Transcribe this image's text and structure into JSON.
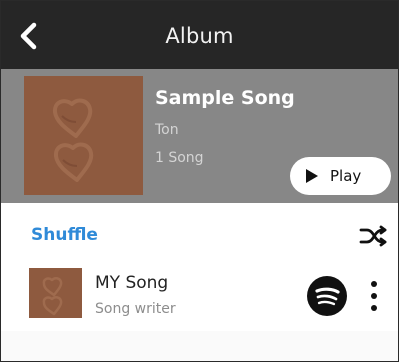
{
  "header": {
    "title": "Album",
    "back_icon": "chevron-left-icon"
  },
  "album": {
    "title": "Sample Song",
    "artist": "Ton",
    "song_count": "1 Song",
    "play_label": "Play",
    "play_icon": "play-icon",
    "cover_art_icon": "album-cover-art"
  },
  "shuffle": {
    "label": "Shuffle",
    "icon": "shuffle-icon"
  },
  "song": {
    "title": "MY Song",
    "writer": "Song writer",
    "service_icon": "spotify-icon",
    "more_icon": "more-vertical-icon"
  },
  "colors": {
    "header_bg": "#262626",
    "album_panel_bg": "#878787",
    "cover_art": "#8e5a3f",
    "shuffle_accent": "#2f8ad8",
    "song_title": "#222222",
    "song_subtitle": "#8d8d8d",
    "play_button_bg": "#ffffff"
  }
}
